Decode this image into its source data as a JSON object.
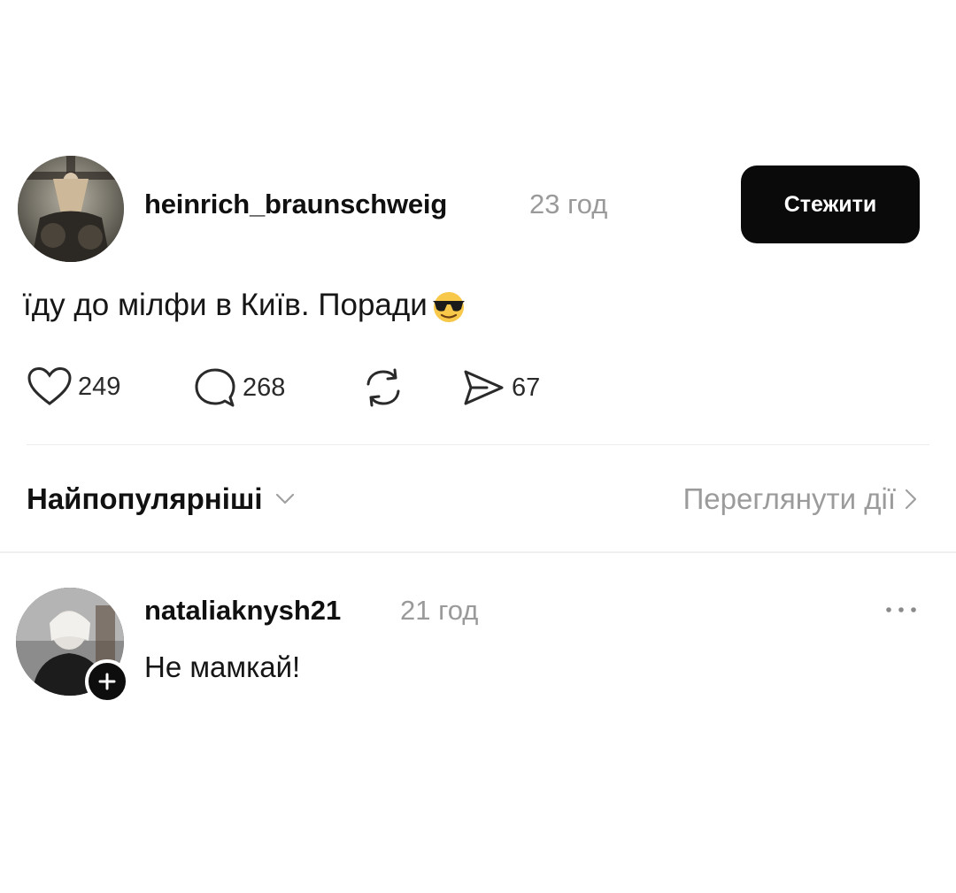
{
  "post": {
    "username": "heinrich_braunschweig",
    "time": "23 год",
    "follow_label": "Стежити",
    "text": "їду до мілфи в Київ. Поради",
    "emoji": "smiling-face-with-sunglasses",
    "likes": "249",
    "comments": "268",
    "shares": "67"
  },
  "sort": {
    "label": "Найпопулярніші",
    "activity_link": "Переглянути дії"
  },
  "reply": {
    "username": "nataliaknysh21",
    "time": "21 год",
    "text": "Не мамкай!"
  },
  "colors": {
    "text": "#101010",
    "muted": "#9a9a9a",
    "button_bg": "#0a0a0a",
    "divider": "#ececec"
  }
}
